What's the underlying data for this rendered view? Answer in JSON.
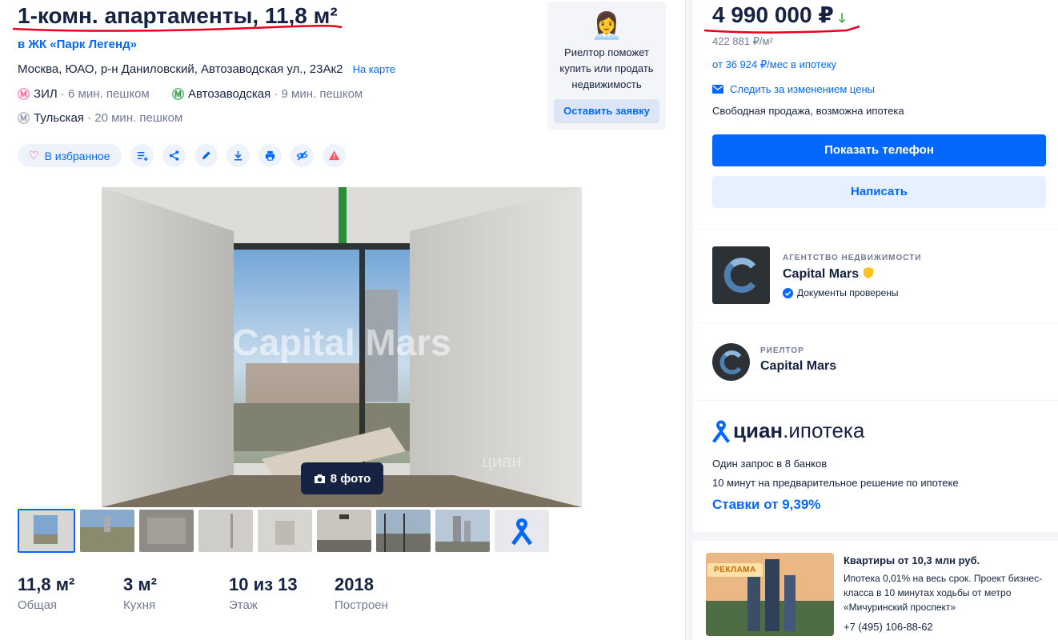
{
  "listing": {
    "title": "1-комн. апартаменты, 11,8 м²",
    "complex_link": "в ЖК «Парк Легенд»",
    "address": "Москва, ЮАО, р-н Даниловский, Автозаводская ул., 23Ак2",
    "map_link": "На карте",
    "metro": [
      {
        "station": "ЗИЛ",
        "time": "· 6 мин. пешком",
        "color": "#ff6ba0",
        "icon": "metro-icon"
      },
      {
        "station": "Автозаводская",
        "time": "· 9 мин. пешком",
        "color": "#1f9e3a",
        "icon": "metro-icon"
      },
      {
        "station": "Тульская",
        "time": "· 20 мин. пешком",
        "color": "#9aa0ad",
        "icon": "metro-icon"
      }
    ]
  },
  "realtor_help": {
    "emoji": "👩‍💼",
    "text": "Риелтор поможет купить или продать недвижимость",
    "button": "Оставить заявку"
  },
  "toolbar": {
    "favorite": "В избранное",
    "icons": [
      "compare-icon",
      "share-icon",
      "edit-icon",
      "download-icon",
      "print-icon",
      "hide-icon",
      "report-icon"
    ]
  },
  "gallery": {
    "watermark_brand": "Capital Mars",
    "watermark_site": "циан",
    "photo_count": "8 фото",
    "thumbnail_count": 8
  },
  "stats": [
    {
      "value": "11,8 м²",
      "label": "Общая"
    },
    {
      "value": "3 м²",
      "label": "Кухня"
    },
    {
      "value": "10 из 13",
      "label": "Этаж"
    },
    {
      "value": "2018",
      "label": "Построен"
    }
  ],
  "price": {
    "value": "4 990 000 ₽",
    "arrow": "🡓",
    "per_m2": "422 881 ₽/м²",
    "mortgage": "от 36 924 ₽/мес в ипотеку",
    "follow": "Следить за изменением цены",
    "sale_info": "Свободная продажа, возможна ипотека",
    "show_phone": "Показать телефон",
    "write": "Написать"
  },
  "agency": {
    "kicker": "АГЕНТСТВО НЕДВИЖИМОСТИ",
    "name": "Capital Mars",
    "verified": "Документы проверены"
  },
  "realtor": {
    "kicker": "РИЕЛТОР",
    "name": "Capital Mars"
  },
  "cian_mortgage": {
    "brand": "циан",
    "product": ".ипотека",
    "line1": "Один запрос в 8 банков",
    "line2": "10 минут на предварительное решение по ипотеке",
    "rates": "Ставки от 9,39%"
  },
  "ad": {
    "badge": "РЕКЛАМА",
    "title": "Квартиры от 10,3 млн руб.",
    "text": "Ипотека 0,01% на весь срок. Проект бизнес-класса в 10 минутах ходьбы от метро «Мичуринский проспект»",
    "phone": "+7 (495) 106-88-62"
  },
  "colors": {
    "accent": "#0468ff",
    "text": "#152242",
    "muted": "#707a95",
    "annotation_red": "#e8001c"
  }
}
